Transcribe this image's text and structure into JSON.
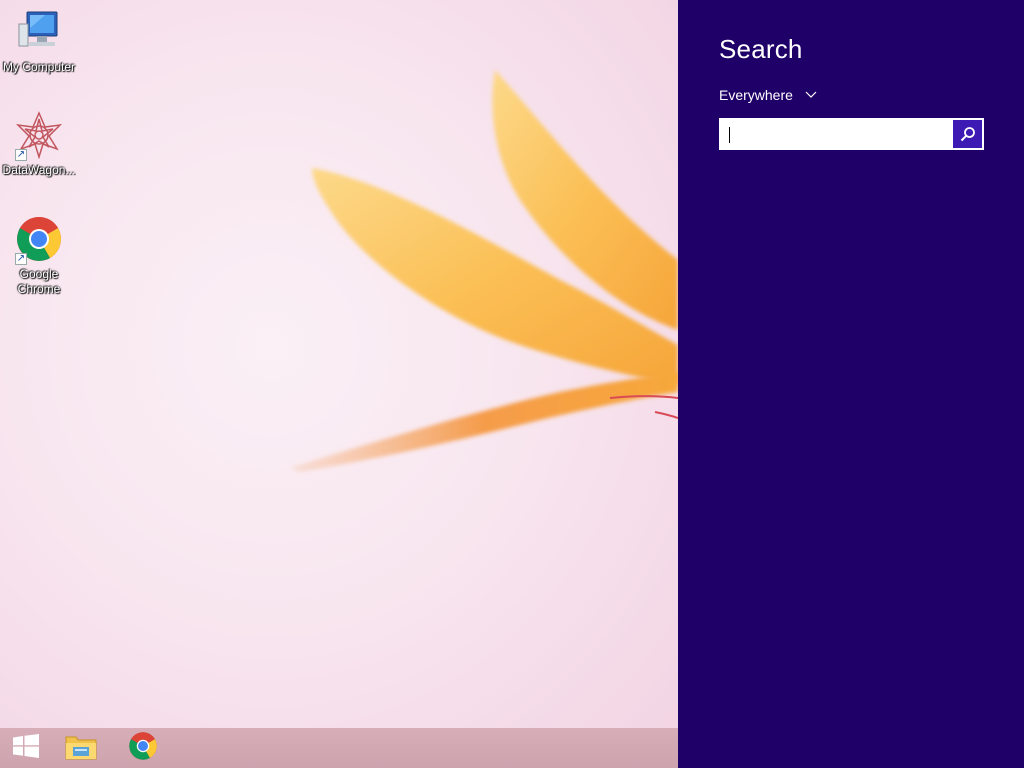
{
  "desktop": {
    "icons": [
      {
        "label": "My Computer",
        "icon": "computer-icon"
      },
      {
        "label": "DataWagon...",
        "icon": "datawagon-icon"
      },
      {
        "label": "Google Chrome",
        "icon": "chrome-icon"
      }
    ]
  },
  "taskbar": {
    "items": [
      {
        "icon": "windows-start-icon"
      },
      {
        "icon": "file-explorer-icon"
      },
      {
        "icon": "chrome-icon"
      }
    ]
  },
  "search_charm": {
    "title": "Search",
    "scope_label": "Everywhere",
    "input_value": "",
    "input_placeholder": "",
    "button_icon": "magnifier-icon",
    "background_color": "#1f0068",
    "button_color": "#3d1ab3"
  }
}
